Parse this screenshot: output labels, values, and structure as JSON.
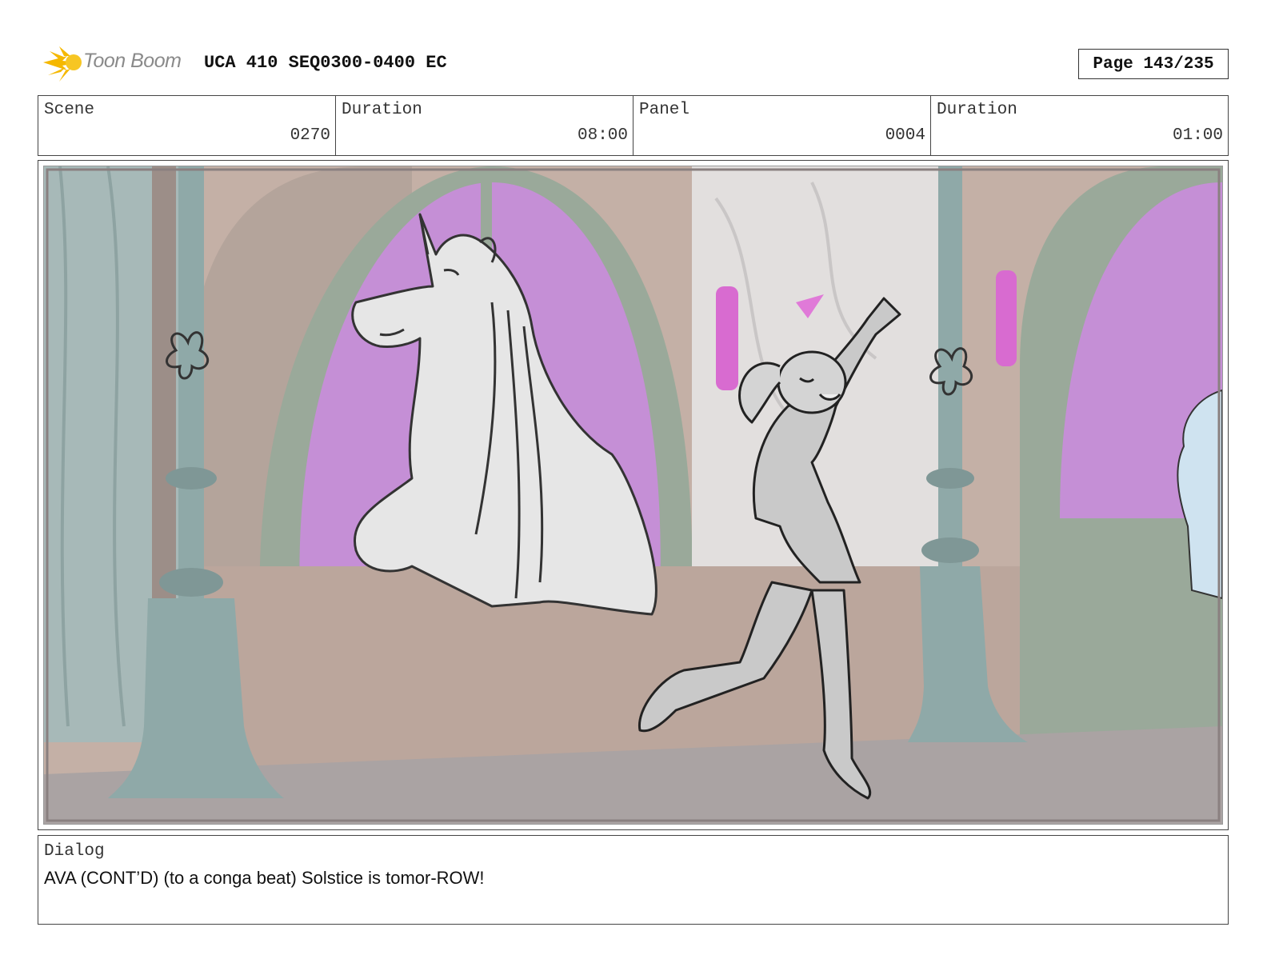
{
  "header": {
    "logo_text": "Toon Boom",
    "title": "UCA 410 SEQ0300-0400 EC",
    "page": "Page 143/235"
  },
  "info": {
    "scene_label": "Scene",
    "scene_value": "0270",
    "scene_duration_label": "Duration",
    "scene_duration_value": "08:00",
    "panel_label": "Panel",
    "panel_value": "0004",
    "panel_duration_label": "Duration",
    "panel_duration_value": "01:00"
  },
  "dialog": {
    "label": "Dialog",
    "text": "AVA (CONT’D) (to a conga beat) Solstice is tomor-ROW!"
  },
  "colors": {
    "logo_yellow": "#f5b800",
    "window_purple": "#c58fd6",
    "arch_green": "#9aa99a",
    "pillar_teal": "#8fa9a8",
    "wall_tan": "#c4b0a6",
    "floor_grey": "#aaa3a3"
  }
}
